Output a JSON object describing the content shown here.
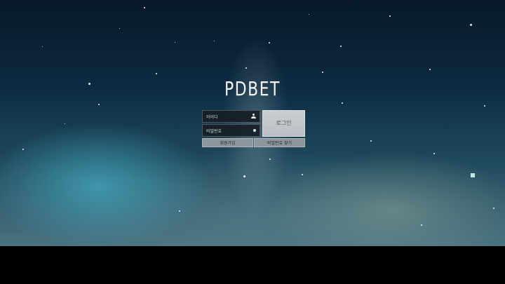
{
  "brand": {
    "logo_text": "PDBET"
  },
  "login_form": {
    "id_label": "아이디",
    "password_label": "비밀번호",
    "login_button_label": "로그인",
    "signup_label": "회원가입",
    "find_password_label": "비밀번호 찾기"
  },
  "icons": {
    "id_field": "user-icon",
    "password_field": "lock-icon"
  },
  "colors": {
    "sky_top": "#07192a",
    "sky_bottom": "#4a7280",
    "nebula_teal": "#46aac3",
    "login_button": "#c9ced2",
    "link_button": "#8d969c",
    "bottom_bar": "#000000"
  }
}
